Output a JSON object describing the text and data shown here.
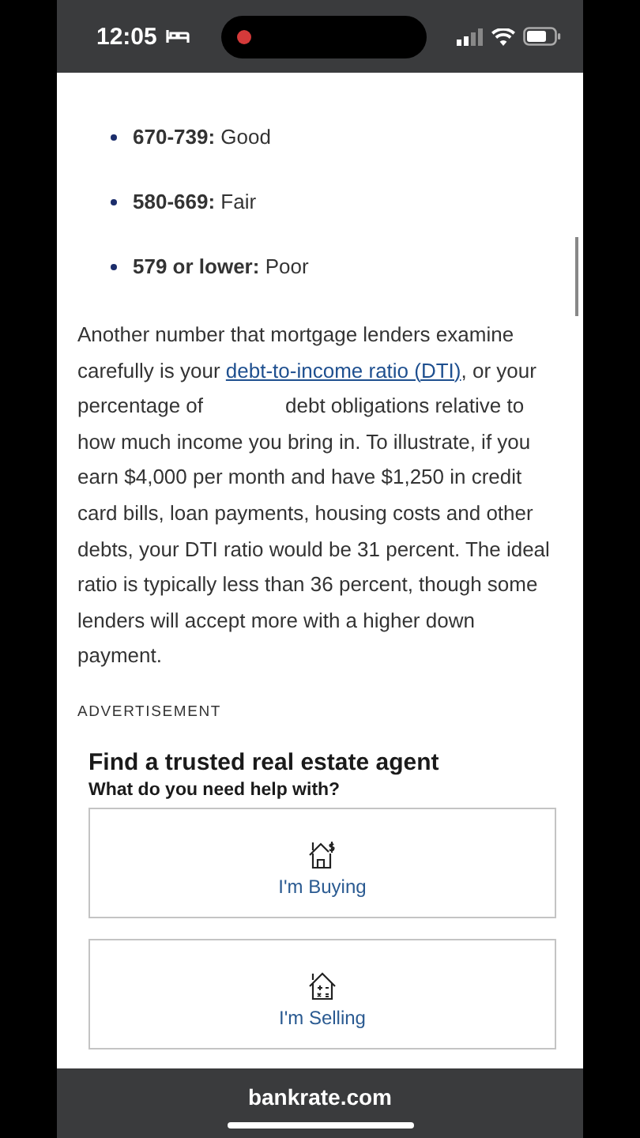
{
  "status_bar": {
    "time": "12:05"
  },
  "score_ranges": [
    {
      "range": "670-739:",
      "label": "Good"
    },
    {
      "range": "580-669:",
      "label": "Fair"
    },
    {
      "range": "579 or lower:",
      "label": "Poor"
    }
  ],
  "paragraph": {
    "before_link": "Another number that mortgage lenders examine carefully is your ",
    "link": "debt-to-income ratio (DTI)",
    "middle": ", or your percentage of",
    "after_hidden": "debt obligations relative to how much income you bring in. To illustrate, if you earn $4,000 per month and have $1,250 in credit card bills, loan payments, housing costs and other debts, your DTI ratio would be 31 percent. The ideal ratio is typically less than 36 percent, though some lenders will accept more with a higher down payment."
  },
  "ad": {
    "label": "ADVERTISEMENT",
    "title": "Find a trusted real estate agent",
    "question": "What do you need help with?",
    "options": [
      {
        "kind": "buying",
        "label": "I'm Buying"
      },
      {
        "kind": "selling",
        "label": "I'm Selling"
      }
    ]
  },
  "address_bar": {
    "domain": "bankrate.com"
  }
}
